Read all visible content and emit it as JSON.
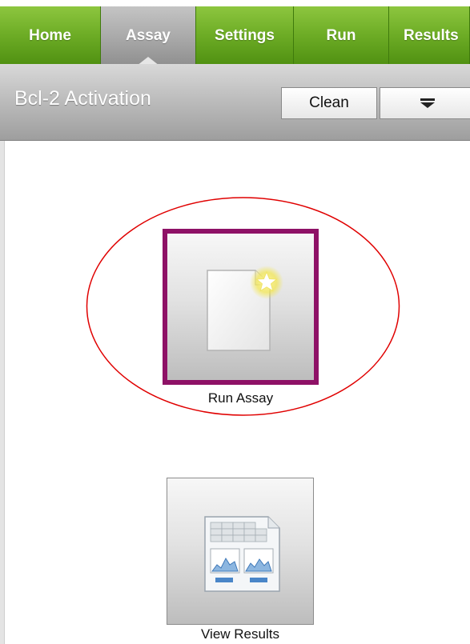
{
  "nav": {
    "tabs": [
      {
        "label": "Home",
        "active": false
      },
      {
        "label": "Assay",
        "active": true
      },
      {
        "label": "Settings",
        "active": false
      },
      {
        "label": "Run",
        "active": false
      },
      {
        "label": "Results",
        "active": false
      }
    ]
  },
  "header": {
    "title": "Bcl-2 Activation",
    "clean_label": "Clean",
    "menu_icon": "menu-dropdown-icon"
  },
  "main": {
    "tiles": [
      {
        "label": "Run Assay",
        "icon": "new-document-star-icon",
        "selected": true
      },
      {
        "label": "View Results",
        "icon": "results-report-icon",
        "selected": false
      }
    ]
  },
  "colors": {
    "tab_green": "#6fae27",
    "tab_active_gray": "#a8a8a8",
    "header_gray": "#bdbdbd",
    "selection_border": "#8e1166",
    "highlight_ellipse": "#e00000"
  }
}
